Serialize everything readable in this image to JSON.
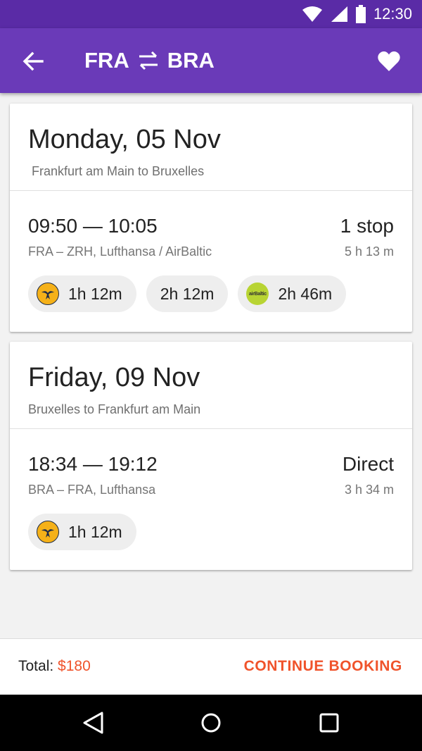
{
  "status_bar": {
    "time": "12:30",
    "icons": [
      "wifi-icon",
      "signal-icon",
      "battery-icon"
    ]
  },
  "app_bar": {
    "origin": "FRA",
    "destination": "BRA",
    "icons": [
      "back-arrow-icon",
      "swap-icon",
      "heart-icon"
    ]
  },
  "colors": {
    "primary": "#6a3ab8",
    "primary_dark": "#5a2ba6",
    "accent": "#f0532b"
  },
  "trips": [
    {
      "date": "Monday, 05 Nov",
      "route_text": "Frankfurt am Main to Bruxelles",
      "times": "09:50 — 10:05",
      "stops": "1 stop",
      "details": "FRA – ZRH, Lufthansa / AirBaltic",
      "duration": "5 h 13 m",
      "legs": [
        {
          "duration": "1h 12m",
          "airline_logo": "lufthansa-logo"
        },
        {
          "duration": "2h 12m",
          "airline_logo": ""
        },
        {
          "duration": "2h 46m",
          "airline_logo": "airbaltic-logo",
          "logo_text": "airBaltic"
        }
      ]
    },
    {
      "date": "Friday, 09 Nov",
      "route_text": "Bruxelles to Frankfurt am Main",
      "times": "18:34 — 19:12",
      "stops": "Direct",
      "details": "BRA – FRA, Lufthansa",
      "duration": "3 h 34 m",
      "legs": [
        {
          "duration": "1h 12m",
          "airline_logo": "lufthansa-logo"
        }
      ]
    }
  ],
  "footer": {
    "total_label": "Total:",
    "total_value": "$180",
    "continue_label": "CONTINUE BOOKING"
  },
  "nav_bar": {
    "icons": [
      "back-triangle-icon",
      "home-circle-icon",
      "recents-square-icon"
    ]
  }
}
